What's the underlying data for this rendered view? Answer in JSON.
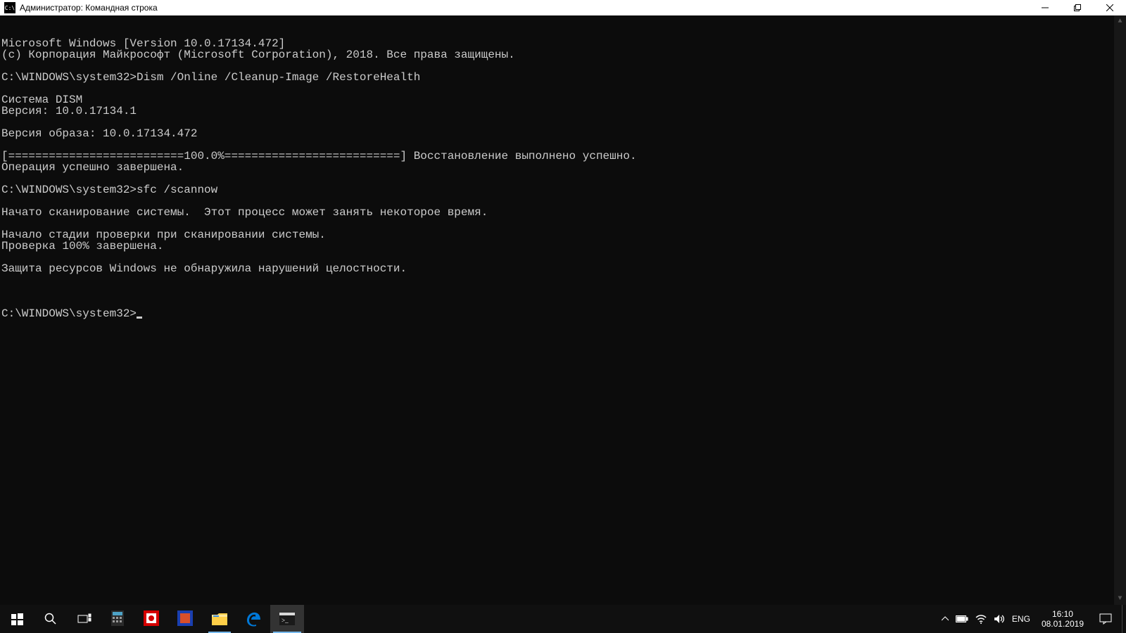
{
  "window": {
    "icon_text": "C:\\",
    "title": "Администратор: Командная строка"
  },
  "console_lines": [
    "Microsoft Windows [Version 10.0.17134.472]",
    "(c) Корпорация Майкрософт (Microsoft Corporation), 2018. Все права защищены.",
    "",
    "C:\\WINDOWS\\system32>Dism /Online /Cleanup-Image /RestoreHealth",
    "",
    "Cистема DISM",
    "Версия: 10.0.17134.1",
    "",
    "Версия образа: 10.0.17134.472",
    "",
    "[==========================100.0%==========================] Восстановление выполнено успешно.",
    "Операция успешно завершена.",
    "",
    "C:\\WINDOWS\\system32>sfc /scannow",
    "",
    "Начато сканирование системы.  Этот процесс может занять некоторое время.",
    "",
    "Начало стадии проверки при сканировании системы.",
    "Проверка 100% завершена.",
    "",
    "Защита ресурсов Windows не обнаружила нарушений целостности.",
    ""
  ],
  "prompt": "C:\\WINDOWS\\system32>",
  "tray": {
    "lang": "ENG",
    "time": "16:10",
    "date": "08.01.2019"
  }
}
